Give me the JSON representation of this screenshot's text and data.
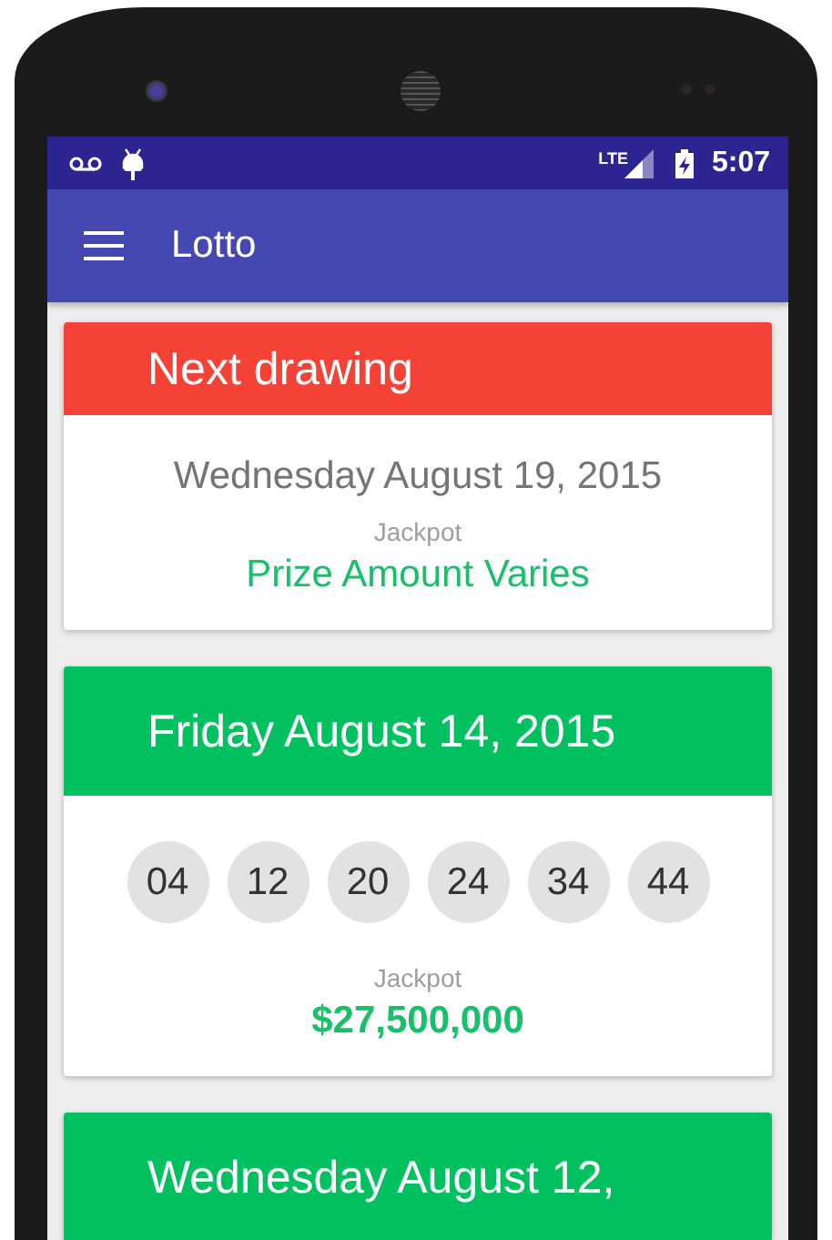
{
  "status_bar": {
    "network": "LTE",
    "time": "5:07"
  },
  "app_bar": {
    "title": "Lotto"
  },
  "cards": [
    {
      "kind": "upcoming",
      "color": "#f44336",
      "title": "Next drawing",
      "date": "Wednesday August 19, 2015",
      "jackpot_label": "Jackpot",
      "jackpot": "Prize Amount Varies"
    },
    {
      "kind": "result",
      "color": "#00c060",
      "title": "Friday August 14, 2015",
      "numbers": [
        "04",
        "12",
        "20",
        "24",
        "34",
        "44"
      ],
      "jackpot_label": "Jackpot",
      "jackpot": "$27,500,000"
    },
    {
      "kind": "result",
      "color": "#00c060",
      "title": "Wednesday August 12,"
    }
  ]
}
